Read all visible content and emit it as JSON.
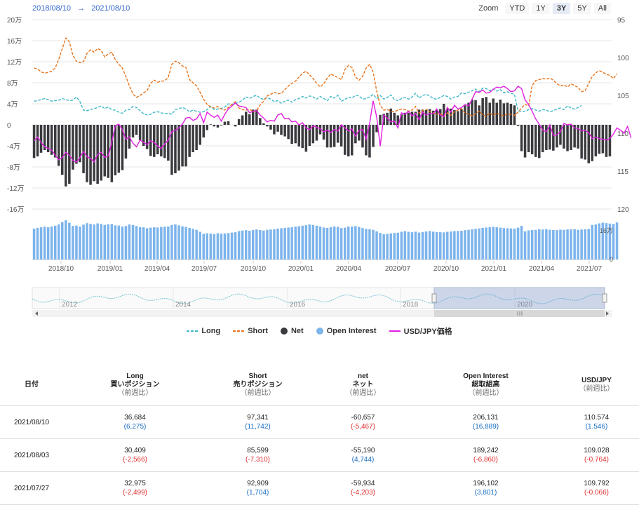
{
  "header": {
    "range_from": "2018/08/10",
    "range_arrow": "→",
    "range_to": "2021/08/10",
    "zoom_label": "Zoom",
    "zoom_buttons": [
      "YTD",
      "1Y",
      "3Y",
      "5Y",
      "All"
    ],
    "zoom_selected": "3Y"
  },
  "colors": {
    "long": "#3fb8c8",
    "short": "#e8731a",
    "net": "#3a3a3f",
    "open_interest": "#7cb4ec",
    "usdjpy": "#e020e0"
  },
  "chart_data": {
    "type": "bar",
    "left_axis_ticks": [
      "20万",
      "16万",
      "12万",
      "8万",
      "4万",
      "0",
      "-4万",
      "-8万",
      "-12万",
      "-16万"
    ],
    "right_axis_ticks": [
      "95",
      "100",
      "105",
      "110",
      "115",
      "120"
    ],
    "right_axis_reversed": true,
    "oi_axis_ticks": [
      "16万",
      "0"
    ],
    "x_ticks": [
      "2018/10",
      "2019/01",
      "2019/04",
      "2019/07",
      "2019/10",
      "2020/01",
      "2020/04",
      "2020/07",
      "2020/10",
      "2021/01",
      "2021/04",
      "2021/07"
    ],
    "navigator_ticks": [
      "2012",
      "2014",
      "2016",
      "2018",
      "2020"
    ],
    "ylim_left": [
      -160000,
      200000
    ],
    "ylim_right": [
      95,
      120
    ],
    "weeks_start": "2018/08/10",
    "weeks_end": "2021/08/10",
    "series": [
      {
        "name": "Long",
        "unit": "万",
        "values": [
          4.5,
          4.6,
          4.8,
          5.0,
          4.8,
          4.5,
          4.6,
          4.7,
          5.0,
          4.8,
          4.6,
          4.7,
          5.3,
          4.4,
          2.8,
          2.7,
          2.9,
          3.1,
          3.3,
          3.6,
          3.1,
          3.4,
          2.9,
          2.8,
          2.4,
          2.2,
          2.8,
          2.9,
          3.5,
          3.3,
          2.7,
          2.1,
          1.9,
          2.0,
          2.4,
          2.5,
          2.3,
          2.1,
          2.2,
          2.0,
          2.9,
          3.1,
          3.3,
          3.0,
          2.5,
          2.8,
          2.6,
          2.4,
          2.5,
          2.9,
          3.5,
          2.9,
          3.0,
          3.1,
          3.4,
          4.0,
          3.9,
          4.1,
          4.3,
          4.7,
          5.3,
          5.0,
          5.4,
          5.6,
          5.1,
          4.8,
          5.2,
          4.9,
          4.4,
          4.6,
          4.1,
          4.5,
          4.7,
          4.3,
          4.8,
          5.0,
          5.4,
          5.1,
          5.5,
          5.3,
          4.9,
          5.4,
          5.0,
          4.6,
          5.4,
          5.1,
          5.6,
          4.5,
          4.8,
          5.3,
          5.1,
          5.6,
          5.5,
          4.9,
          5.0,
          5.3,
          5.8,
          5.0,
          5.6,
          4.9,
          5.2,
          5.7,
          4.8,
          4.6,
          5.0,
          5.2,
          4.9,
          5.3,
          6.0,
          5.1,
          5.6,
          5.8,
          5.5,
          5.0,
          4.9,
          5.2,
          5.6,
          5.4,
          4.9,
          5.3,
          5.4,
          6.1,
          5.9,
          6.2,
          6.5,
          6.8,
          6.3,
          7.0,
          6.9,
          6.5,
          6.8,
          6.4,
          6.7,
          6.1,
          6.3,
          6.0,
          5.8,
          2.7,
          2.5,
          2.6,
          2.9,
          3.1,
          2.8,
          2.6,
          2.9,
          2.8,
          2.5,
          2.7,
          3.0,
          3.2,
          2.9,
          3.6,
          3.2,
          3.0,
          3.3,
          3.7
        ]
      },
      {
        "name": "Short",
        "unit": "万",
        "values": [
          10.8,
          10.6,
          10.1,
          9.8,
          10.0,
          10.2,
          10.8,
          12.5,
          14.5,
          16.5,
          15.8,
          13.2,
          12.1,
          11.8,
          12.0,
          13.6,
          14.3,
          13.8,
          14.5,
          14.2,
          12.9,
          13.5,
          13.8,
          12.4,
          11.5,
          10.8,
          9.2,
          7.4,
          5.9,
          5.2,
          5.6,
          6.1,
          6.5,
          7.9,
          8.5,
          8.1,
          8.3,
          8.4,
          9.0,
          11.5,
          12.1,
          11.8,
          11.2,
          10.9,
          8.6,
          8.0,
          7.4,
          6.2,
          4.9,
          3.9,
          3.4,
          3.2,
          3.5,
          3.0,
          2.8,
          3.3,
          3.9,
          4.4,
          3.2,
          2.9,
          2.8,
          3.0,
          2.5,
          2.7,
          3.8,
          4.5,
          5.5,
          5.8,
          6.2,
          5.9,
          6.0,
          6.7,
          7.4,
          7.9,
          8.3,
          9.1,
          9.8,
          10.2,
          9.5,
          8.8,
          7.9,
          7.2,
          7.8,
          8.9,
          9.7,
          9.3,
          9.0,
          8.6,
          10.5,
          11.3,
          10.9,
          9.1,
          8.5,
          9.2,
          10.8,
          11.5,
          10.0,
          6.4,
          3.7,
          2.8,
          2.9,
          2.6,
          2.5,
          2.8,
          3.0,
          2.9,
          2.6,
          2.8,
          3.5,
          2.2,
          2.7,
          3.0,
          2.5,
          2.3,
          2.0,
          2.2,
          1.6,
          2.3,
          1.8,
          2.5,
          2.8,
          3.1,
          2.2,
          2.0,
          1.7,
          2.1,
          2.6,
          1.9,
          1.6,
          2.3,
          1.8,
          2.2,
          1.9,
          1.7,
          2.1,
          2.0,
          1.8,
          2.4,
          3.2,
          3.9,
          3.6,
          7.5,
          8.4,
          8.6,
          8.8,
          8.7,
          8.9,
          8.5,
          7.8,
          7.4,
          7.6,
          7.2,
          7.8,
          7.5,
          7.1,
          6.3,
          6.5,
          7.9,
          9.2,
          9.9,
          10.3,
          10.0,
          9.6,
          9.4,
          8.8,
          9.7
        ]
      },
      {
        "name": "Net",
        "unit": "万",
        "values": [
          -6.3,
          -6.0,
          -5.3,
          -4.8,
          -5.2,
          -5.7,
          -6.2,
          -7.8,
          -9.5,
          -11.7,
          -11.2,
          -8.5,
          -7.4,
          -7.1,
          -9.2,
          -10.9,
          -11.4,
          -10.7,
          -11.2,
          -10.6,
          -9.8,
          -10.1,
          -10.9,
          -9.6,
          -9.1,
          -8.6,
          -6.4,
          -4.5,
          -2.4,
          -1.9,
          -2.9,
          -4.0,
          -4.6,
          -5.9,
          -6.1,
          -5.6,
          -6.0,
          -6.3,
          -6.8,
          -9.5,
          -9.2,
          -8.7,
          -7.9,
          -7.9,
          -6.1,
          -5.2,
          -4.8,
          -3.8,
          -2.4,
          -1.0,
          0.1,
          -0.3,
          -0.5,
          -0.1,
          0.6,
          0.7,
          0.0,
          -0.3,
          1.1,
          1.8,
          2.5,
          2.0,
          2.9,
          2.9,
          1.3,
          0.3,
          -0.3,
          -0.9,
          -1.8,
          -1.3,
          -1.9,
          -2.2,
          -2.7,
          -3.6,
          -3.5,
          -4.1,
          -4.4,
          -5.1,
          -4.0,
          -3.5,
          -3.0,
          -1.8,
          -2.8,
          -4.3,
          -4.3,
          -4.2,
          -3.4,
          -4.1,
          -5.7,
          -6.0,
          -5.8,
          -3.5,
          -3.0,
          -4.3,
          -5.8,
          -6.2,
          -4.2,
          -1.4,
          1.9,
          2.1,
          2.3,
          3.1,
          2.3,
          1.8,
          2.0,
          2.3,
          2.3,
          2.5,
          2.5,
          2.9,
          2.9,
          2.8,
          3.0,
          2.7,
          2.9,
          3.0,
          4.0,
          3.1,
          3.1,
          2.8,
          2.6,
          3.0,
          3.7,
          4.2,
          4.8,
          4.7,
          3.7,
          5.1,
          5.3,
          4.2,
          5.0,
          4.2,
          4.8,
          4.1,
          4.2,
          4.0,
          3.7,
          -0.2,
          -5.0,
          -6.2,
          -5.2,
          -5.6,
          -6.1,
          -6.3,
          -5.2,
          -4.8,
          -4.7,
          -4.9,
          -4.3,
          -3.8,
          -4.5,
          -5.0,
          -4.8,
          -4.3,
          -4.5,
          -6.4,
          -6.6,
          -7.3,
          -6.9,
          -6.0,
          -5.5,
          -5.4,
          -6.1,
          -6.0
        ]
      },
      {
        "name": "Open Interest",
        "unit": "万",
        "values": [
          17.2,
          17.6,
          17.9,
          18.3,
          17.9,
          18.4,
          18.8,
          19.5,
          20.8,
          21.8,
          20.4,
          18.7,
          18.9,
          18.3,
          19.4,
          20.2,
          19.8,
          19.5,
          20.1,
          19.8,
          19.2,
          19.6,
          19.8,
          19.0,
          18.9,
          18.3,
          18.6,
          19.5,
          19.2,
          18.6,
          18.0,
          17.9,
          17.4,
          17.7,
          17.9,
          17.8,
          18.1,
          18.3,
          18.4,
          19.2,
          19.5,
          19.0,
          18.5,
          18.2,
          17.6,
          17.1,
          16.5,
          15.4,
          14.3,
          14.6,
          14.4,
          14.2,
          14.6,
          14.4,
          14.5,
          14.7,
          15.0,
          15.2,
          15.8,
          16.1,
          16.3,
          16.0,
          16.4,
          16.7,
          16.4,
          16.1,
          16.5,
          16.7,
          16.8,
          17.2,
          17.4,
          17.6,
          17.8,
          18.0,
          18.3,
          18.5,
          18.8,
          19.1,
          19.5,
          19.2,
          18.8,
          18.4,
          17.8,
          17.6,
          18.0,
          18.4,
          18.2,
          17.5,
          17.7,
          18.3,
          18.4,
          18.6,
          18.2,
          17.5,
          17.1,
          16.8,
          16.5,
          15.7,
          14.8,
          14.1,
          14.3,
          14.5,
          14.7,
          14.9,
          15.4,
          15.8,
          15.4,
          15.2,
          15.5,
          15.0,
          15.3,
          15.6,
          15.9,
          15.5,
          15.3,
          15.2,
          15.1,
          15.4,
          15.6,
          15.8,
          15.9,
          16.0,
          16.3,
          16.5,
          16.8,
          17.0,
          17.3,
          17.6,
          17.8,
          18.0,
          18.2,
          18.0,
          17.7,
          17.5,
          17.4,
          17.3,
          17.2,
          17.7,
          18.7,
          15.7,
          16.2,
          16.4,
          16.5,
          16.8,
          16.7,
          16.9,
          16.5,
          16.4,
          16.3,
          16.6,
          16.5,
          16.7,
          16.8,
          16.9,
          16.5,
          16.7,
          16.8,
          17.0,
          19.2,
          19.5,
          20.1,
          20.5,
          20.2,
          20.0,
          19.8,
          20.6
        ]
      },
      {
        "name": "USD/JPY価格",
        "unit": "円",
        "values": [
          111.0,
          110.5,
          111.2,
          111.8,
          112.0,
          112.2,
          112.9,
          113.5,
          113.2,
          112.5,
          112.9,
          113.6,
          113.8,
          113.2,
          112.4,
          113.1,
          113.3,
          113.8,
          112.8,
          112.5,
          113.2,
          113.0,
          111.2,
          109.0,
          108.8,
          109.5,
          110.8,
          110.5,
          111.3,
          111.8,
          110.9,
          111.2,
          111.5,
          111.0,
          111.2,
          111.7,
          112.0,
          111.4,
          110.9,
          109.8,
          109.6,
          109.3,
          108.8,
          108.0,
          107.9,
          108.3,
          108.1,
          107.4,
          108.6,
          107.2,
          107.6,
          107.9,
          107.6,
          108.4,
          107.5,
          106.8,
          106.4,
          106.0,
          106.4,
          106.5,
          106.6,
          107.3,
          107.1,
          107.0,
          107.6,
          108.0,
          108.5,
          108.3,
          108.4,
          107.6,
          107.4,
          108.1,
          108.0,
          108.5,
          108.4,
          108.9,
          108.6,
          109.3,
          109.5,
          109.0,
          109.2,
          109.4,
          109.8,
          109.6,
          109.9,
          109.5,
          109.7,
          108.9,
          109.3,
          109.7,
          109.4,
          110.4,
          109.6,
          109.5,
          110.8,
          108.7,
          105.7,
          107.9,
          111.7,
          107.6,
          108.0,
          108.5,
          108.4,
          109.3,
          107.3,
          107.5,
          107.1,
          107.7,
          107.4,
          108.2,
          107.2,
          107.6,
          107.4,
          107.4,
          106.8,
          107.6,
          107.8,
          106.6,
          107.2,
          106.3,
          106.8,
          106.6,
          106.2,
          106.4,
          105.5,
          104.5,
          104.6,
          104.3,
          104.7,
          104.6,
          104.2,
          103.9,
          104.0,
          103.8,
          104.1,
          104.5,
          104.4,
          103.8,
          104.1,
          105.6,
          106.2,
          107.1,
          108.1,
          108.8,
          109.6,
          109.8,
          108.9,
          110.3,
          110.2,
          109.8,
          108.7,
          108.9,
          108.8,
          109.3,
          109.4,
          109.7,
          109.6,
          109.9,
          110.7,
          110.5,
          110.7,
          110.8,
          110.9,
          110.7,
          110.1,
          109.3,
          109.6,
          110.0,
          109.1,
          110.6
        ]
      }
    ]
  },
  "legend": [
    {
      "label": "Long",
      "kind": "dash"
    },
    {
      "label": "Short",
      "kind": "dash"
    },
    {
      "label": "Net",
      "kind": "dot"
    },
    {
      "label": "Open Interest",
      "kind": "dot"
    },
    {
      "label": "USD/JPY価格",
      "kind": "line"
    }
  ],
  "table": {
    "headers": [
      {
        "line1": "日付",
        "line2": "",
        "line3": ""
      },
      {
        "line1": "Long",
        "line2": "買いポジション",
        "line3": "（前週比）"
      },
      {
        "line1": "Short",
        "line2": "売りポジション",
        "line3": "（前週比）"
      },
      {
        "line1": "net",
        "line2": "ネット",
        "line3": "（前週比）"
      },
      {
        "line1": "Open Interest",
        "line2": "総取組高",
        "line3": "（前週比）"
      },
      {
        "line1": "USD/JPY",
        "line2": "（前週比）",
        "line3": ""
      }
    ],
    "rows": [
      {
        "date": "2021/08/10",
        "long": "36,684",
        "long_chg": "(6,275)",
        "long_sign": "pos",
        "short": "97,341",
        "short_chg": "(11,742)",
        "short_sign": "pos",
        "net": "-60,657",
        "net_chg": "(-5,467)",
        "net_sign": "neg",
        "oi": "206,131",
        "oi_chg": "(16,889)",
        "oi_sign": "pos",
        "fx": "110.574",
        "fx_chg": "(1.546)",
        "fx_sign": "pos"
      },
      {
        "date": "2021/08/03",
        "long": "30,409",
        "long_chg": "(-2,566)",
        "long_sign": "neg",
        "short": "85,599",
        "short_chg": "(-7,310)",
        "short_sign": "neg",
        "net": "-55,190",
        "net_chg": "(4,744)",
        "net_sign": "pos",
        "oi": "189,242",
        "oi_chg": "(-6,860)",
        "oi_sign": "neg",
        "fx": "109.028",
        "fx_chg": "(-0.764)",
        "fx_sign": "neg"
      },
      {
        "date": "2021/07/27",
        "long": "32,975",
        "long_chg": "(-2,499)",
        "long_sign": "neg",
        "short": "92,909",
        "short_chg": "(1,704)",
        "short_sign": "pos",
        "net": "-59,934",
        "net_chg": "(-4,203)",
        "net_sign": "neg",
        "oi": "196,102",
        "oi_chg": "(3,801)",
        "oi_sign": "pos",
        "fx": "109.792",
        "fx_chg": "(-0.066)",
        "fx_sign": "neg"
      }
    ]
  }
}
